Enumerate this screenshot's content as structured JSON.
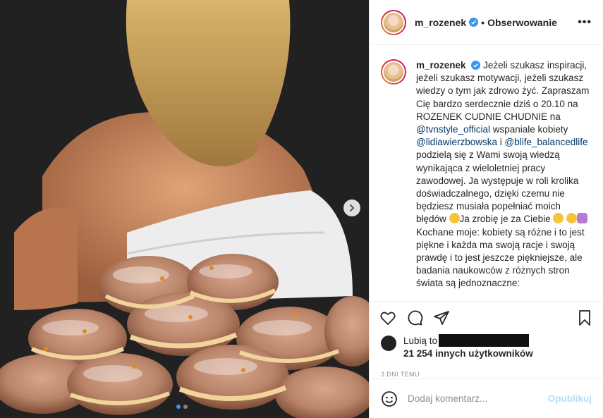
{
  "post": {
    "username": "m_rozenek",
    "bullet": "•",
    "follow_status": "Obserwowanie",
    "more": "•••"
  },
  "caption": {
    "username": "m_rozenek",
    "text_1": "Jeżeli szukasz inspiracji, jeżeli szukasz motywacji, jeżeli szukasz wiedzy o tym jak zdrowo żyć. Zapraszam Cię bardzo serdecznie dziś o 20.10 na ROZENEK CUDNIE CHUDNIE na ",
    "mention_1": "@tvnstyle_official",
    "text_2": " wspaniale kobiety ",
    "mention_2": "@lidiawierzbowska",
    "text_3": " i ",
    "mention_3": "@blife_balancedlife",
    "text_4": " podzielą się z Wami swoją wiedzą wynikająca z wieloletniej pracy zawodowej. Ja występuje w roli krolika doświadczalnego, dzięki czemu nie będziesz musiała popełniać moich błędów ",
    "text_5": "Ja zrobię je za Ciebie ",
    "text_6": " Kochane moje: kobiety są różne i to jest piękne i każda ma swoją racje i swoją prawdę i to jest jeszcze piękniejsze, ale badania naukowców z różnych stron świata są jednoznaczne:"
  },
  "likes": {
    "prefix": "Lubią to",
    "count_text": "21 254 innych użytkowników"
  },
  "timestamp": "3 DNI TEMU",
  "comment": {
    "placeholder": "Dodaj komentarz...",
    "publish": "Opublikuj"
  },
  "carousel": {
    "slides": 2,
    "active_index": 0
  },
  "colors": {
    "verified": "#3897f0",
    "mention": "#00376b",
    "publish_disabled": "#b2dffc",
    "muted": "#8e8e8e"
  }
}
